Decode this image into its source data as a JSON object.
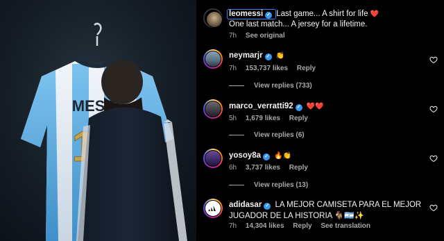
{
  "post": {
    "author": "leomessi",
    "caption_line1": "Last game... A shirt for life",
    "caption_line1_emoji": "❤️",
    "caption_line2": "One last match... A jersey for a lifetime.",
    "time": "7h",
    "see_original": "See original"
  },
  "comments": [
    {
      "username": "neymarjr",
      "text": "👏",
      "time": "7h",
      "likes": "153,737 likes",
      "reply": "Reply",
      "view_replies": "View replies (733)"
    },
    {
      "username": "marco_verratti92",
      "text": "❤️❤️",
      "time": "5h",
      "likes": "1,679 likes",
      "reply": "Reply",
      "view_replies": "View replies (6)"
    },
    {
      "username": "yosoy8a",
      "text": "🔥👏",
      "time": "6h",
      "likes": "3,737 likes",
      "reply": "Reply",
      "view_replies": "View replies (13)"
    },
    {
      "username": "adidasar",
      "text": "LA MEJOR CAMISETA PARA EL MEJOR",
      "text_line2": "JUGADOR DE LA HISTORIA 🐐🇦🇷✨",
      "time": "7h",
      "likes": "14,304 likes",
      "reply": "Reply",
      "see_translation": "See translation"
    }
  ],
  "photo": {
    "jersey_name": "MESSI",
    "jersey_number": "10"
  },
  "colors": {
    "background": "#000000",
    "text": "#f5f5f5",
    "secondary": "#a8a8a8",
    "verified": "#3897f0",
    "jersey_sky_blue": "#6fb8e6",
    "number_gold": "#c8a24a"
  },
  "icons": {
    "verified": "verified-badge-icon",
    "like": "heart-outline-icon"
  }
}
